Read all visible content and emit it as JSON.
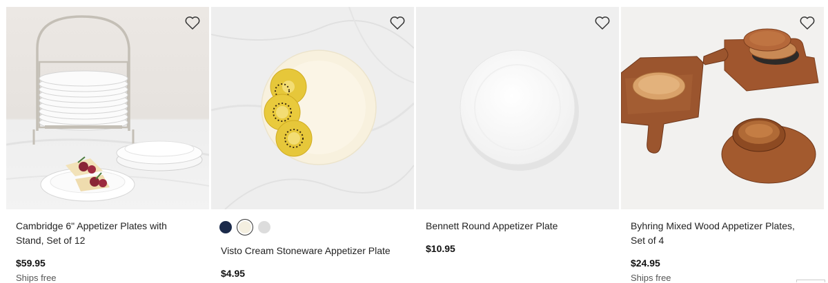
{
  "products": [
    {
      "title": "Cambridge 6\" Appetizer Plates with Stand, Set of 12",
      "price": "$59.95",
      "shipping": "Ships free",
      "image": "plates-with-wire-stand",
      "favorite_icon": "heart-outline-icon"
    },
    {
      "title": "Visto Cream Stoneware Appetizer Plate",
      "price": "$4.95",
      "image": "cream-plate-with-kiwi-slices",
      "favorite_icon": "heart-outline-icon",
      "swatches": [
        {
          "name": "navy",
          "color": "#1b2a4a",
          "selected": false
        },
        {
          "name": "cream",
          "color": "#f4efe0",
          "selected": true
        },
        {
          "name": "gray",
          "color": "#dcdcdc",
          "selected": false
        }
      ]
    },
    {
      "title": "Bennett Round Appetizer Plate",
      "price": "$10.95",
      "image": "white-round-plate",
      "favorite_icon": "heart-outline-icon"
    },
    {
      "title": "Byhring Mixed Wood Appetizer Plates, Set of 4",
      "price": "$24.95",
      "shipping": "Ships free",
      "image": "mixed-wood-plates-and-boards",
      "favorite_icon": "heart-outline-icon"
    }
  ]
}
